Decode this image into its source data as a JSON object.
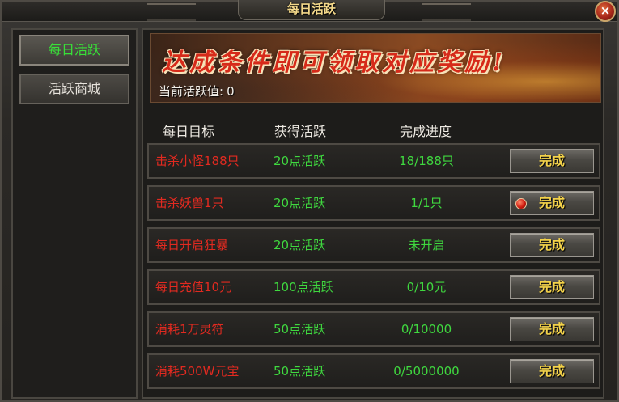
{
  "window": {
    "title": "每日活跃",
    "close_label": "×"
  },
  "sidebar": {
    "tabs": [
      {
        "label": "每日活跃",
        "active": true
      },
      {
        "label": "活跃商城",
        "active": false
      }
    ]
  },
  "banner": {
    "headline": "达成条件即可领取对应奖励!",
    "activity_label": "当前活跃值:",
    "activity_value": "0"
  },
  "table": {
    "headers": [
      "每日目标",
      "获得活跃",
      "完成进度"
    ],
    "rows": [
      {
        "goal": "击杀小怪188只",
        "reward": "20点活跃",
        "progress": "18/188只",
        "button": "完成",
        "alert": false
      },
      {
        "goal": "击杀妖兽1只",
        "reward": "20点活跃",
        "progress": "1/1只",
        "button": "完成",
        "alert": true
      },
      {
        "goal": "每日开启狂暴",
        "reward": "20点活跃",
        "progress": "未开启",
        "button": "完成",
        "alert": false
      },
      {
        "goal": "每日充值10元",
        "reward": "100点活跃",
        "progress": "0/10元",
        "button": "完成",
        "alert": false
      },
      {
        "goal": "消耗1万灵符",
        "reward": "50点活跃",
        "progress": "0/10000",
        "button": "完成",
        "alert": false
      },
      {
        "goal": "消耗500W元宝",
        "reward": "50点活跃",
        "progress": "0/5000000",
        "button": "完成",
        "alert": false
      }
    ]
  },
  "colors": {
    "goal_text": "#e22a20",
    "reward_text": "#3fd83f",
    "button_text": "#f3d24a",
    "active_tab_text": "#38e038"
  }
}
